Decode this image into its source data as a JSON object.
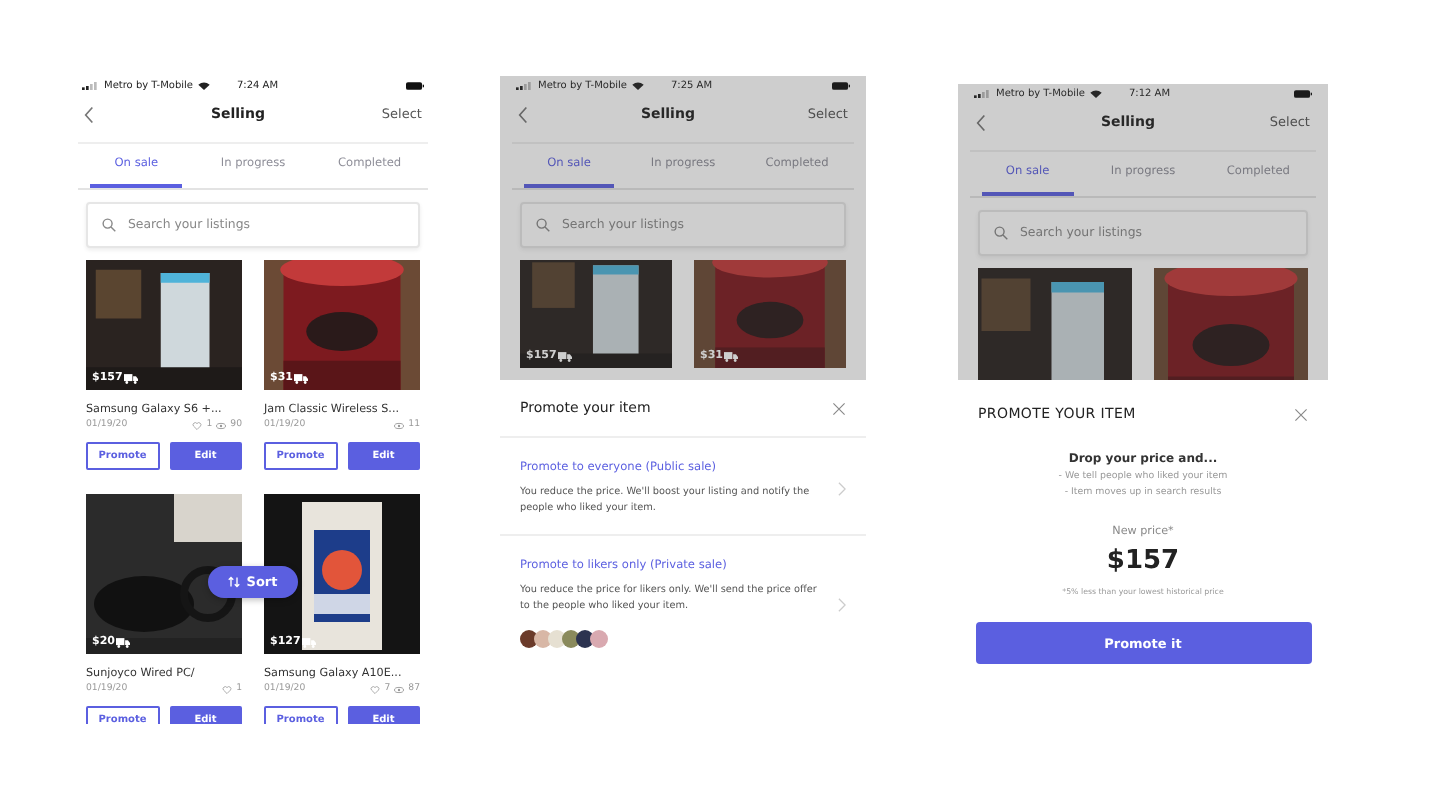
{
  "screens": [
    {
      "kind": "listings",
      "status_bar": {
        "carrier": "Metro by T-Mobile",
        "time": "7:24 AM"
      },
      "nav": {
        "title": "Selling",
        "action": "Select"
      },
      "tabs": [
        {
          "label": "On sale",
          "selected": true
        },
        {
          "label": "In progress",
          "selected": false
        },
        {
          "label": "Completed",
          "selected": false
        }
      ],
      "search": {
        "placeholder": "Search your listings"
      },
      "listings": [
        {
          "price": "$157",
          "title": "Samsung Galaxy S6 +...",
          "date": "01/19/20",
          "likes": "1",
          "views": "90",
          "promote": "Promote",
          "edit": "Edit"
        },
        {
          "price": "$31",
          "title": "Jam Classic Wireless S...",
          "date": "01/19/20",
          "views": "11",
          "promote": "Promote",
          "edit": "Edit"
        },
        {
          "price": "$20",
          "title": "Sunjoyco Wired PC/",
          "date": "01/19/20",
          "likes": "1",
          "promote": "Promote",
          "edit": "Edit"
        },
        {
          "price": "$127",
          "title": "Samsung Galaxy A10E...",
          "date": "01/19/20",
          "likes": "7",
          "views": "87",
          "promote": "Promote",
          "edit": "Edit"
        }
      ],
      "sort_button": "Sort"
    },
    {
      "kind": "promote_options",
      "status_bar": {
        "carrier": "Metro by T-Mobile",
        "time": "7:25 AM"
      },
      "nav": {
        "title": "Selling",
        "action": "Select"
      },
      "tabs": [
        {
          "label": "On sale",
          "selected": true
        },
        {
          "label": "In progress",
          "selected": false
        },
        {
          "label": "Completed",
          "selected": false
        }
      ],
      "search": {
        "placeholder": "Search your listings"
      },
      "listings": [
        {
          "price": "$157"
        },
        {
          "price": "$31"
        }
      ],
      "sheet": {
        "title": "Promote your item",
        "options": [
          {
            "title": "Promote to everyone (Public sale)",
            "description": "You reduce the price. We'll boost your listing and notify the people who liked your item.",
            "shows_likers": false
          },
          {
            "title": "Promote to likers only (Private sale)",
            "description": "You reduce the price for likers only. We'll send the price offer to the people who liked your item.",
            "shows_likers": true
          }
        ]
      }
    },
    {
      "kind": "promote_price",
      "status_bar": {
        "carrier": "Metro by T-Mobile",
        "time": "7:12 AM"
      },
      "nav": {
        "title": "Selling",
        "action": "Select"
      },
      "tabs": [
        {
          "label": "On sale",
          "selected": true
        },
        {
          "label": "In progress",
          "selected": false
        },
        {
          "label": "Completed",
          "selected": false
        }
      ],
      "search": {
        "placeholder": "Search your listings"
      },
      "listings": [
        {
          "kind": "picture"
        },
        {
          "kind": "picture"
        }
      ],
      "sheet": {
        "title": "PROMOTE YOUR ITEM",
        "heading": "Drop your price and...",
        "bullets": [
          "- We tell people who liked your item",
          "- Item moves up in search results"
        ],
        "price_label": "New price*",
        "price": "$157",
        "footnote": "*5% less than your lowest historical price",
        "button": "Promote it"
      }
    }
  ]
}
